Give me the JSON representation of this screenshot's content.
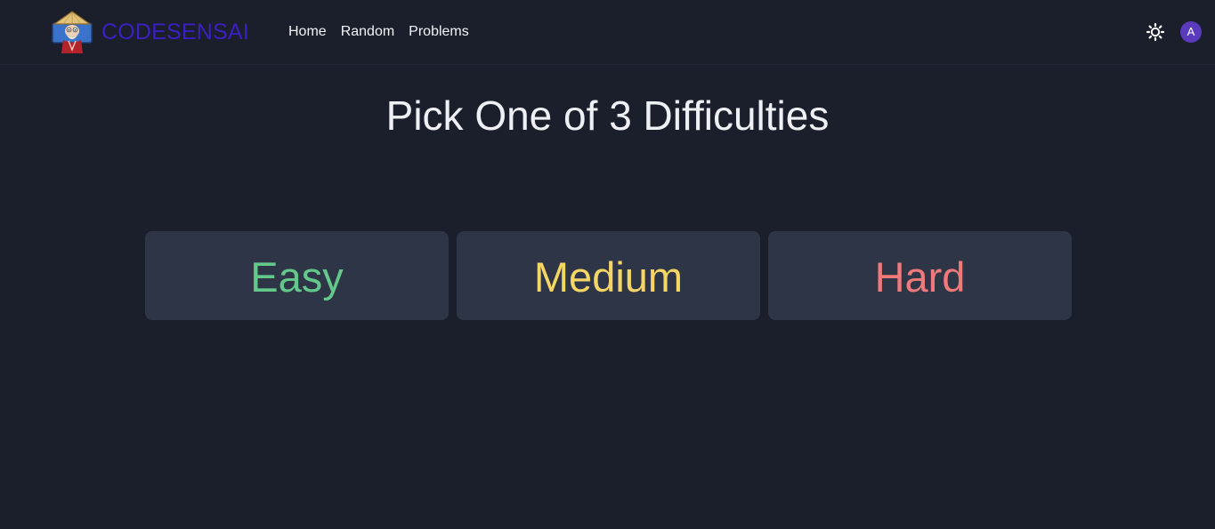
{
  "brand": {
    "name": "CODESENSAI",
    "name_color": "#3b1fc2",
    "logo_icon": "sensei-mascot-icon"
  },
  "nav": {
    "links": [
      {
        "label": "Home"
      },
      {
        "label": "Random"
      },
      {
        "label": "Problems"
      }
    ]
  },
  "header_actions": {
    "theme_toggle_icon": "sun-icon",
    "avatar_initial": "A",
    "avatar_color": "#5a3bbd"
  },
  "main": {
    "title": "Pick One of 3 Difficulties",
    "difficulties": [
      {
        "label": "Easy",
        "color": "#63c98a"
      },
      {
        "label": "Medium",
        "color": "#f4d566"
      },
      {
        "label": "Hard",
        "color": "#f07a7a"
      }
    ]
  },
  "theme": {
    "background": "#1b1f2b",
    "card_background": "#2e3546",
    "text": "#eef0f4"
  }
}
